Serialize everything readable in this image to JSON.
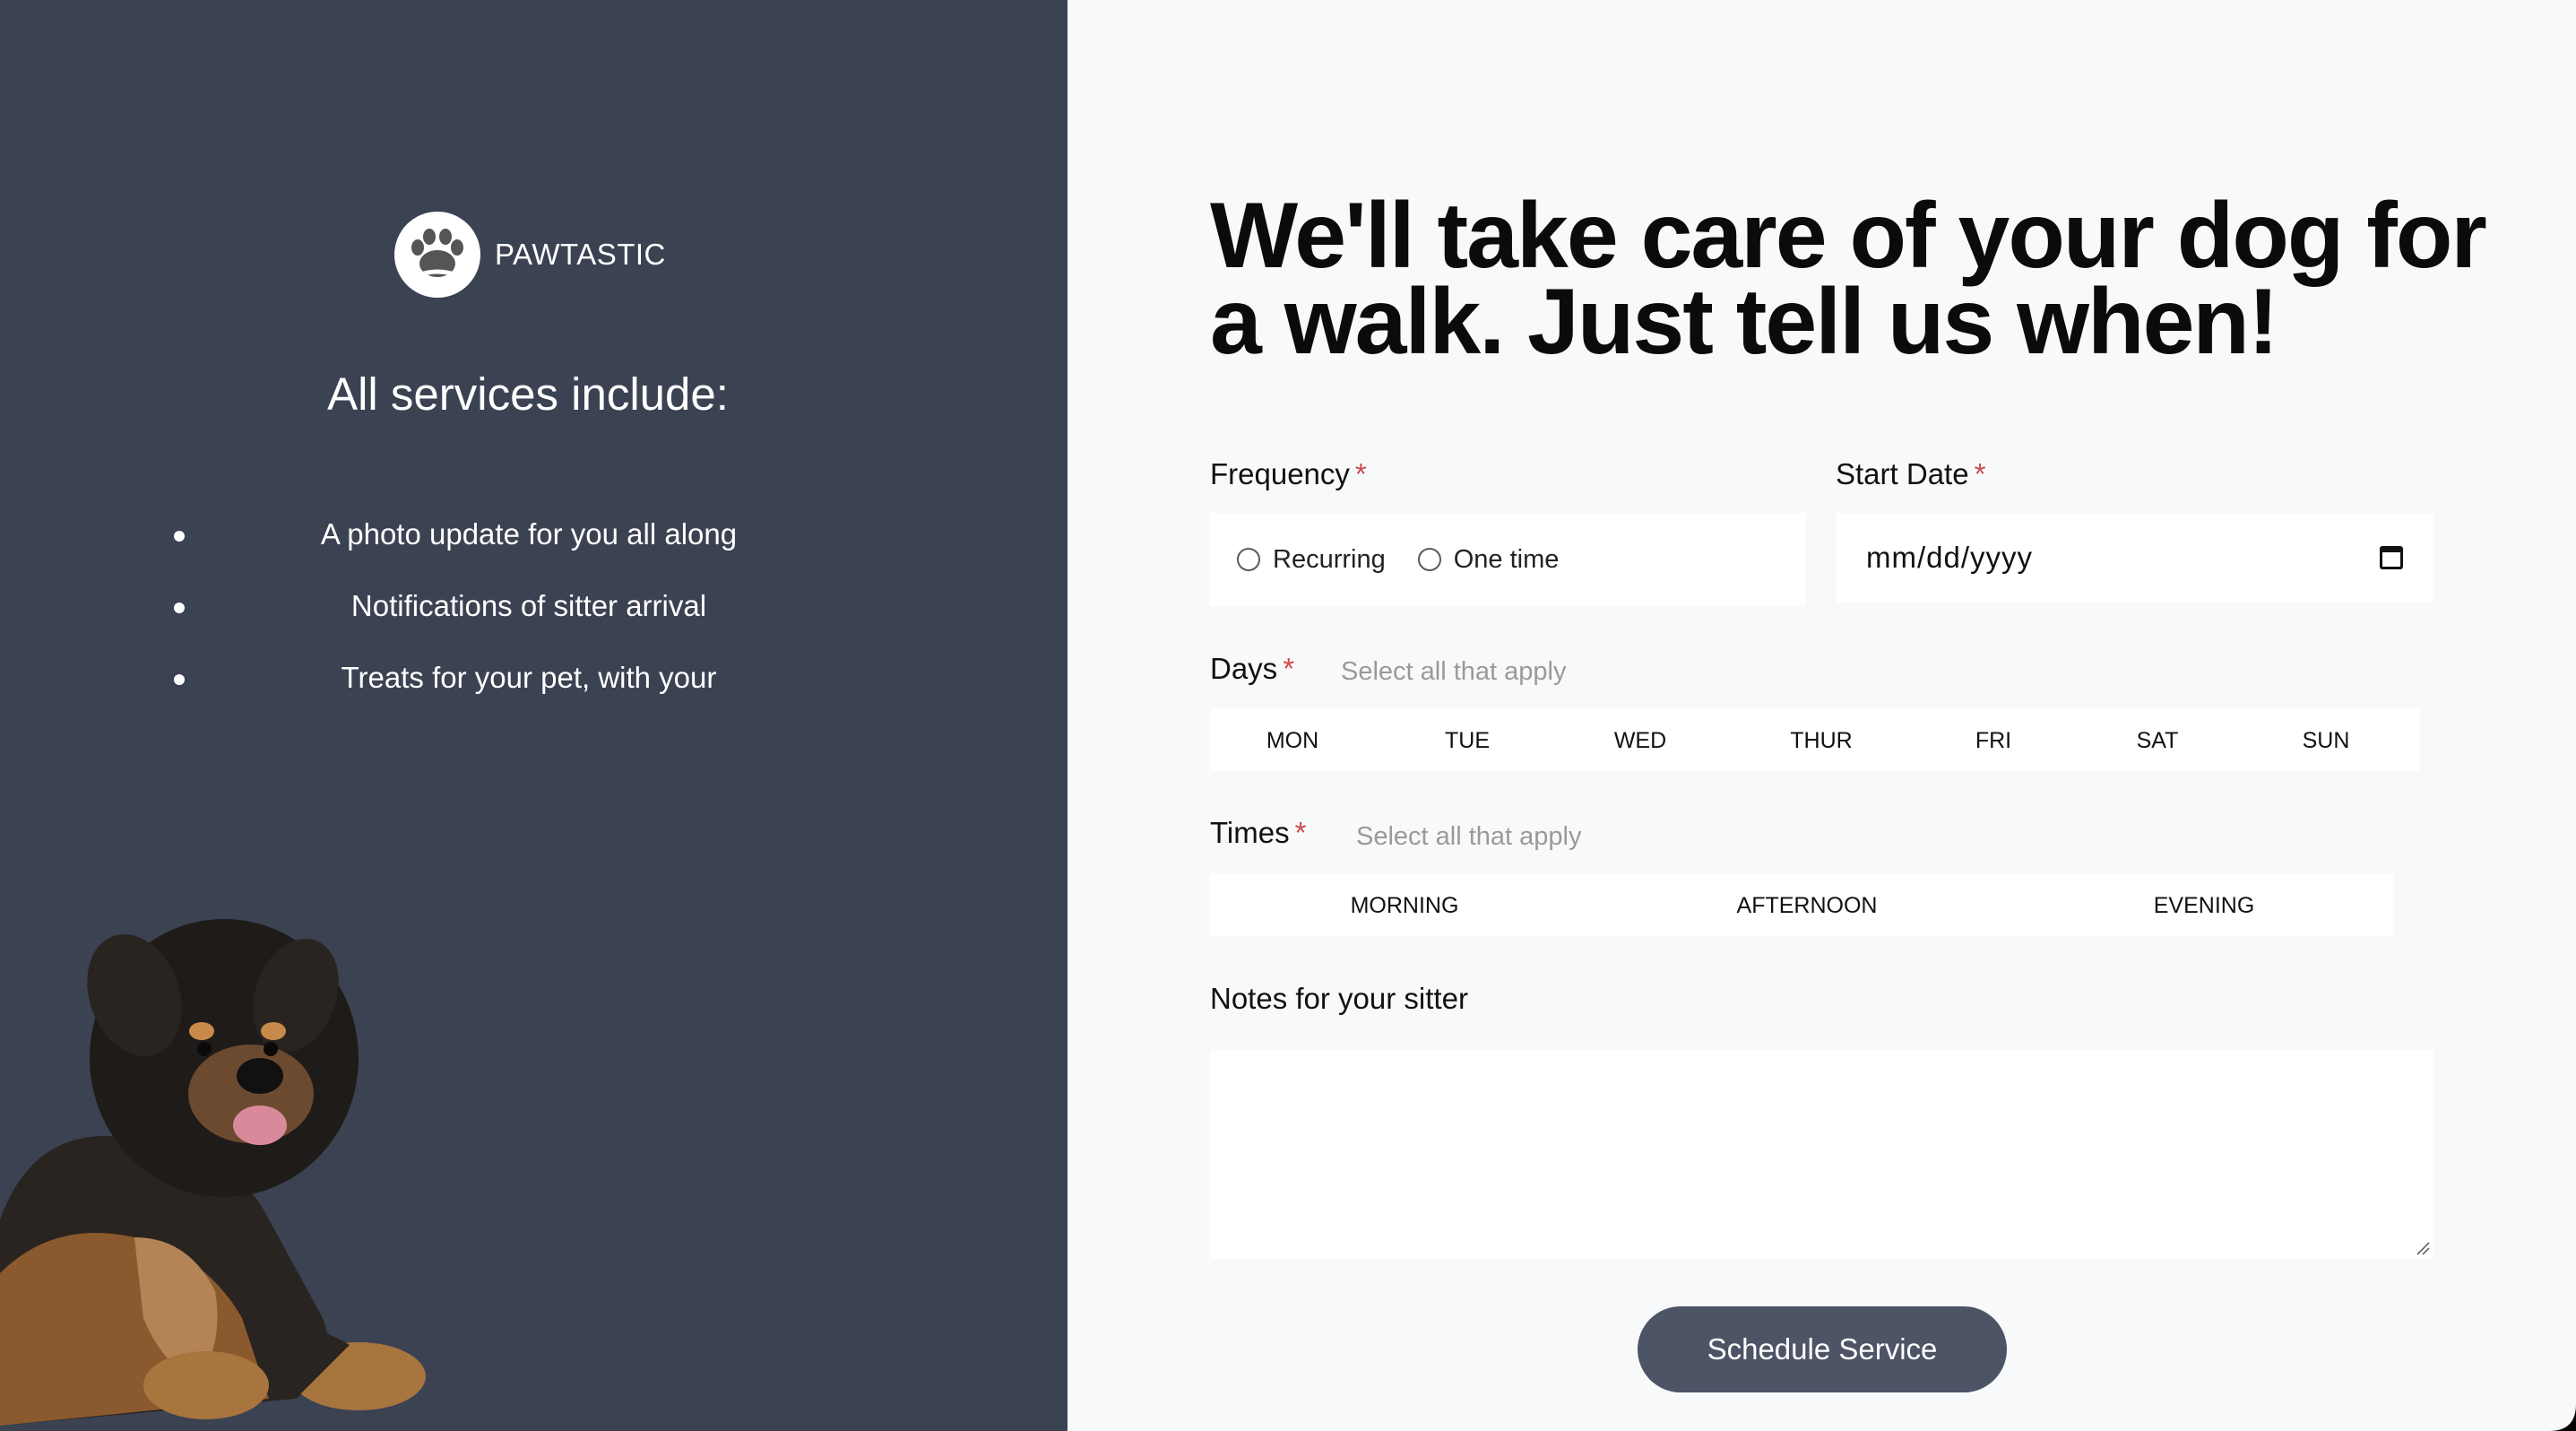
{
  "brand": {
    "name": "PAWTASTIC",
    "logo_icon": "paw-icon"
  },
  "services": {
    "heading": "All services include:",
    "items": [
      "A photo update for you all along",
      "Notifications of sitter arrival",
      "Treats for your pet, with your"
    ]
  },
  "form": {
    "headline": "We'll take care of your dog for a walk. Just tell us when!",
    "required_mark": "*",
    "frequency": {
      "label": "Frequency",
      "options": [
        "Recurring",
        "One time"
      ]
    },
    "start_date": {
      "label": "Start Date",
      "placeholder": "mm/dd/yyyy",
      "icon": "calendar-icon"
    },
    "days": {
      "label": "Days",
      "hint": "Select all that apply",
      "options": [
        "MON",
        "TUE",
        "WED",
        "THUR",
        "FRI",
        "SAT",
        "SUN"
      ]
    },
    "times": {
      "label": "Times",
      "hint": "Select all that apply",
      "options": [
        "MORNING",
        "AFTERNOON",
        "EVENING"
      ]
    },
    "notes": {
      "label": "Notes for your sitter",
      "value": ""
    },
    "submit_label": "Schedule Service"
  },
  "colors": {
    "left_panel": "#3b4252",
    "right_panel": "#f8f9fb",
    "required": "#d04a4a",
    "button": "#4d5466"
  }
}
